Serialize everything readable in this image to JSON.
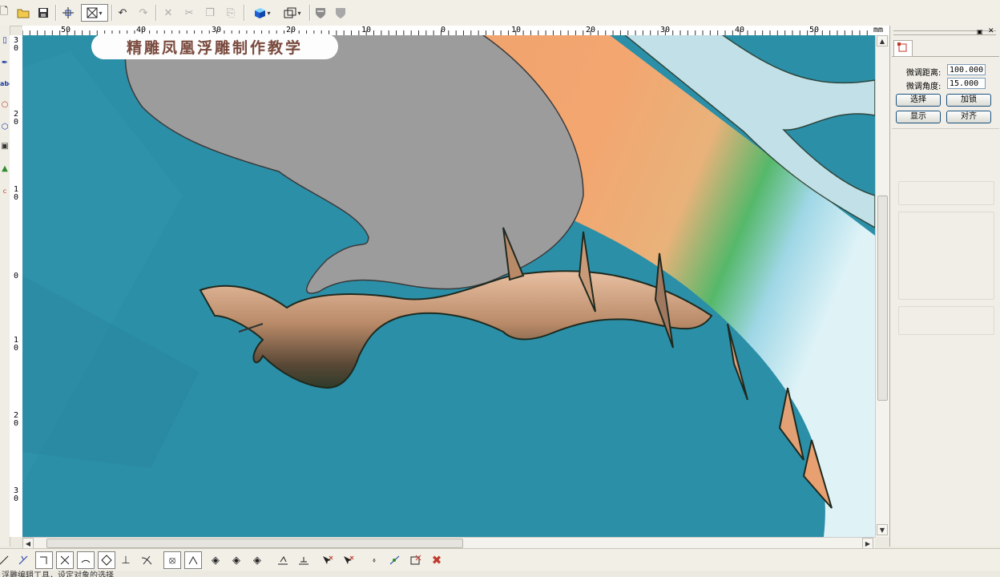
{
  "banner": {
    "title": "精雕凤凰浮雕制作教学"
  },
  "ruler": {
    "unit": "mm",
    "h_labels": [
      "50",
      "40",
      "30",
      "20",
      "10",
      "0",
      "10",
      "20",
      "30",
      "40",
      "50"
    ],
    "v_labels": [
      "3",
      "2",
      "1",
      "0",
      "1",
      "2",
      "3"
    ]
  },
  "panel": {
    "tab_icon": "node-edit-icon",
    "distance_label": "微调距离:",
    "distance_value": "100.000",
    "angle_label": "微调角度:",
    "angle_value": "15.000",
    "btn_select": "选择",
    "btn_lock": "加锁",
    "btn_show": "显示",
    "btn_align": "对齐"
  },
  "status": {
    "text": "浮雕编辑工具，设定对象的选择"
  },
  "colors": {
    "canvas_bg": "#2b8fa8",
    "banner_text": "#7a4a3e",
    "accent_button_border": "#1c5180"
  },
  "toolbar_icons": {
    "top": [
      "new-file-icon",
      "open-folder-icon",
      "save-icon",
      "crosshair-icon",
      "view-frame-icon",
      "undo-icon",
      "redo-icon",
      "delete-icon",
      "cut-icon",
      "copy-icon",
      "paste-icon",
      "color-cube-icon",
      "view-box-icon",
      "shield-icon",
      "shield-filled-icon"
    ],
    "bottom": [
      "line-icon",
      "node-icon",
      "corner-icon",
      "cross-icon",
      "arc-icon",
      "circle-node-icon",
      "perpendicular-icon",
      "tangent-icon",
      "point-icon",
      "angle-icon",
      "diamond-icon",
      "diamond-left-icon",
      "diamond-right-icon",
      "plane-icon",
      "plane-align-icon",
      "select-arrow-icon",
      "select-cross-icon",
      "transform-icon",
      "snap-icon",
      "clear-icon",
      "close-x-icon"
    ]
  }
}
